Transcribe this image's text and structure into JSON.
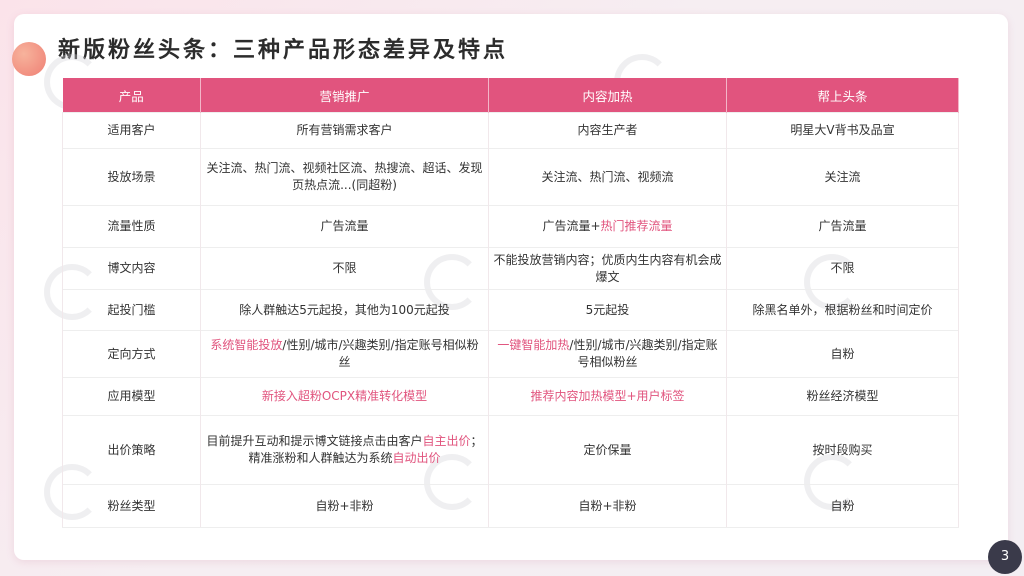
{
  "title": "新版粉丝头条：三种产品形态差异及特点",
  "page_number": "3",
  "headers": [
    "产品",
    "营销推广",
    "内容加热",
    "帮上头条"
  ],
  "rows": [
    {
      "label": "适用客户",
      "cells": [
        [
          {
            "t": "所有营销需求客户"
          }
        ],
        [
          {
            "t": "内容生产者"
          }
        ],
        [
          {
            "t": "明星大V背书及品宣"
          }
        ]
      ]
    },
    {
      "label": "投放场景",
      "cells": [
        [
          {
            "t": "关注流、热门流、视频社区流、热搜流、超话、发现页热点流...(同超粉)"
          }
        ],
        [
          {
            "t": "关注流、热门流、视频流"
          }
        ],
        [
          {
            "t": "关注流"
          }
        ]
      ]
    },
    {
      "label": "流量性质",
      "cells": [
        [
          {
            "t": "广告流量"
          }
        ],
        [
          {
            "t": "广告流量+"
          },
          {
            "t": "热门推荐流量",
            "hl": true
          }
        ],
        [
          {
            "t": "广告流量"
          }
        ]
      ]
    },
    {
      "label": "博文内容",
      "cells": [
        [
          {
            "t": "不限"
          }
        ],
        [
          {
            "t": "不能投放营销内容；优质内生内容有机会成爆文"
          }
        ],
        [
          {
            "t": "不限"
          }
        ]
      ]
    },
    {
      "label": "起投门槛",
      "cells": [
        [
          {
            "t": "除人群触达5元起投，其他为100元起投"
          }
        ],
        [
          {
            "t": "5元起投"
          }
        ],
        [
          {
            "t": "除黑名单外，根据粉丝和时间定价"
          }
        ]
      ]
    },
    {
      "label": "定向方式",
      "cells": [
        [
          {
            "t": "系统智能投放",
            "hl": true
          },
          {
            "t": "/性别/城市/兴趣类别/指定账号相似粉丝"
          }
        ],
        [
          {
            "t": "一键智能加热",
            "hl": true
          },
          {
            "t": "/性别/城市/兴趣类别/指定账号相似粉丝"
          }
        ],
        [
          {
            "t": "自粉"
          }
        ]
      ]
    },
    {
      "label": "应用模型",
      "cells": [
        [
          {
            "t": "新接入超粉OCPX精准转化模型",
            "hl": true
          }
        ],
        [
          {
            "t": "推荐内容加热模型+用户标签",
            "hl": true
          }
        ],
        [
          {
            "t": "粉丝经济模型"
          }
        ]
      ]
    },
    {
      "label": "出价策略",
      "cells": [
        [
          {
            "t": "目前提升互动和提示博文链接点击由客户"
          },
          {
            "t": "自主出价",
            "hl": true
          },
          {
            "t": "；精准涨粉和人群触达为系统"
          },
          {
            "t": "自动出价",
            "hl": true
          }
        ],
        [
          {
            "t": "定价保量"
          }
        ],
        [
          {
            "t": "按时段购买"
          }
        ]
      ]
    },
    {
      "label": "粉丝类型",
      "cells": [
        [
          {
            "t": "自粉+非粉"
          }
        ],
        [
          {
            "t": "自粉+非粉"
          }
        ],
        [
          {
            "t": "自粉"
          }
        ]
      ]
    }
  ]
}
